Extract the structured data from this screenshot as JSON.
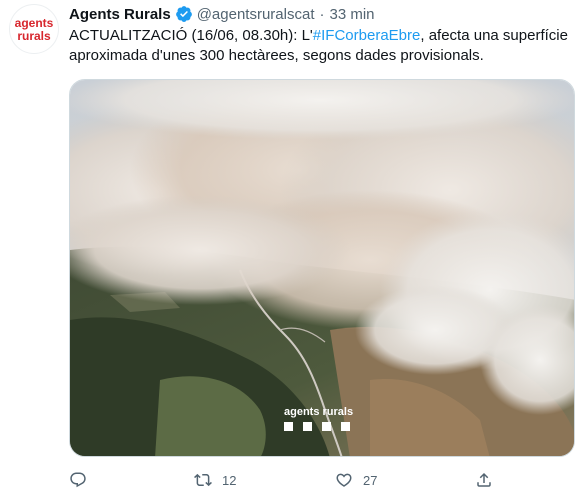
{
  "tweet": {
    "author_name": "Agents Rurals",
    "handle": "@agentsruralscat",
    "separator": "·",
    "time": "33 min",
    "text_before": "ACTUALITZACIÓ (16/06, 08.30h): L'",
    "hashtag": "#IFCorberaEbre",
    "text_after": ", afecta una superfície aproximada d'unes 300 hectàrees, segons dades provisionals.",
    "avatar_logo": "agents rurals",
    "watermark": "agents rurals"
  },
  "actions": {
    "reply_count": "",
    "retweet_count": "12",
    "like_count": "27"
  },
  "colors": {
    "accent": "#1d9bf0",
    "secondary_text": "#536471",
    "logo_red": "#d7262d"
  },
  "icons": [
    "verified-badge-icon",
    "reply-icon",
    "retweet-icon",
    "like-icon",
    "share-icon"
  ]
}
